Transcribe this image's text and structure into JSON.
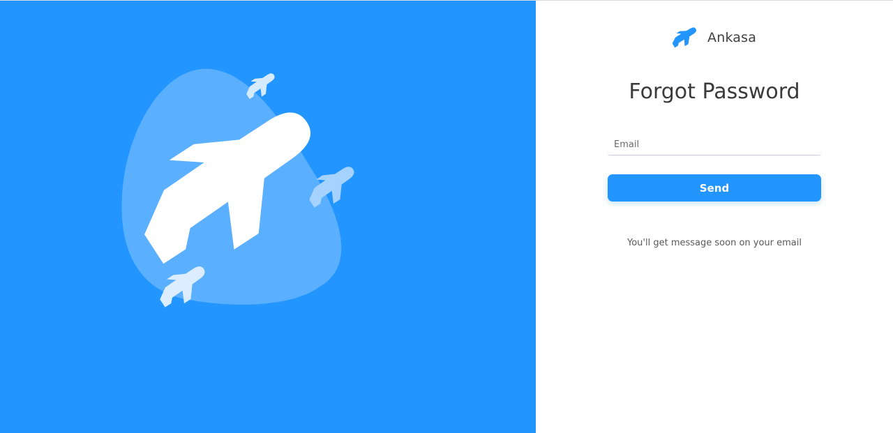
{
  "brand": {
    "name": "Ankasa",
    "logo_icon": "airplane-icon"
  },
  "page": {
    "title": "Forgot Password",
    "email_placeholder": "Email",
    "send_label": "Send",
    "note": "You'll get message soon on your email"
  },
  "hero": {
    "illustration": "airplane-blob-illustration",
    "background_color": "#2395ff",
    "blob_color": "#5aafff"
  },
  "colors": {
    "accent": "#2395ff",
    "title": "#3a3a3a",
    "text": "#595959",
    "input_underline": "#c8c9e6"
  }
}
